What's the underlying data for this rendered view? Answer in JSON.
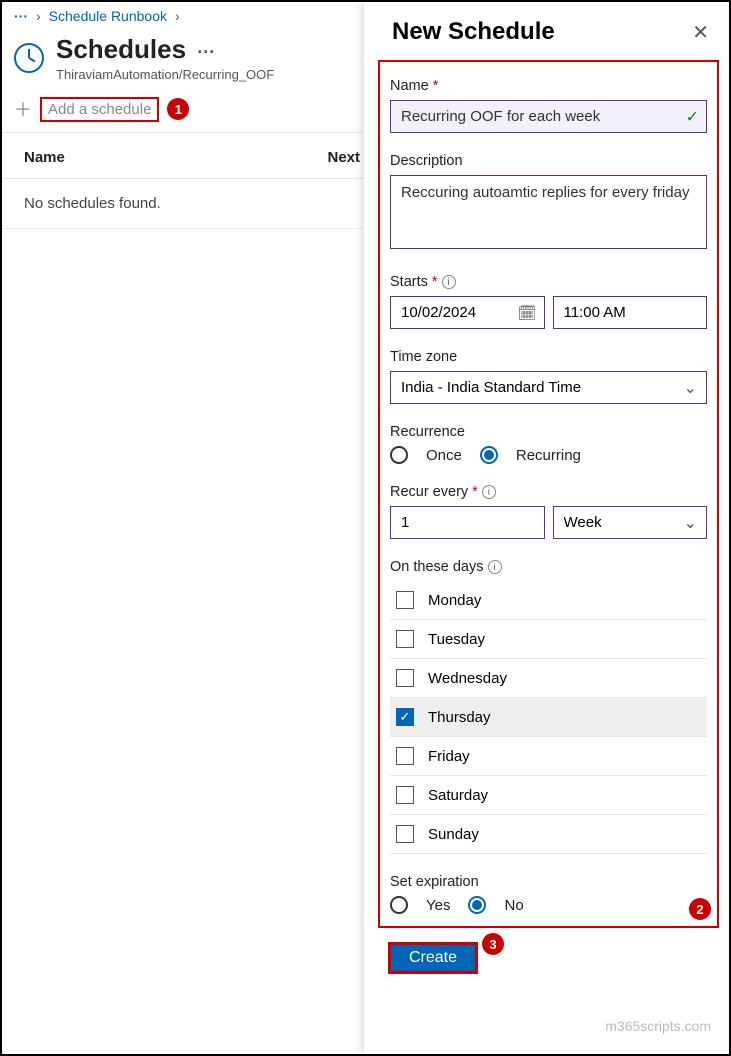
{
  "breadcrumb": {
    "dots": "···",
    "link": "Schedule Runbook"
  },
  "page": {
    "title": "Schedules",
    "subtitle": "ThiraviamAutomation/Recurring_OOF",
    "more": "···"
  },
  "toolbar": {
    "add_label": "Add a schedule"
  },
  "grid": {
    "col_name": "Name",
    "col_next": "Next",
    "empty": "No schedules found."
  },
  "panel": {
    "title": "New Schedule",
    "name_label": "Name",
    "name_value": "Recurring OOF for each week",
    "desc_label": "Description",
    "desc_value": "Reccuring autoamtic replies for every friday",
    "starts_label": "Starts",
    "starts_date": "10/02/2024",
    "starts_time": "11:00 AM",
    "tz_label": "Time zone",
    "tz_value": "India - India Standard Time",
    "recurrence_label": "Recurrence",
    "recurrence_once": "Once",
    "recurrence_recurring": "Recurring",
    "recur_every_label": "Recur every",
    "recur_every_value": "1",
    "recur_unit": "Week",
    "days_label": "On these days",
    "days": [
      "Monday",
      "Tuesday",
      "Wednesday",
      "Thursday",
      "Friday",
      "Saturday",
      "Sunday"
    ],
    "days_selected_index": 3,
    "exp_label": "Set expiration",
    "exp_yes": "Yes",
    "exp_no": "No",
    "create_label": "Create"
  },
  "callouts": {
    "c1": "1",
    "c2": "2",
    "c3": "3"
  },
  "watermark": "m365scripts.com"
}
